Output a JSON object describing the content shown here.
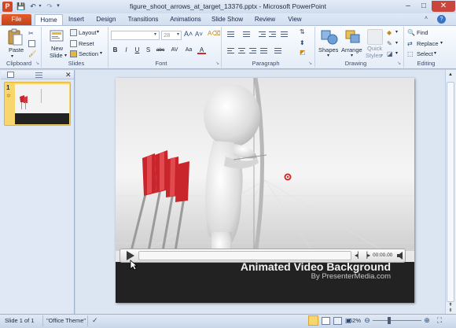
{
  "window": {
    "title": "figure_shoot_arrows_at_target_13376.pptx - Microsoft PowerPoint",
    "app_icon_letter": "P",
    "minimize": "–",
    "maximize": "□",
    "close": "✕"
  },
  "tabs": [
    "File",
    "Home",
    "Insert",
    "Design",
    "Transitions",
    "Animations",
    "Slide Show",
    "Review",
    "View"
  ],
  "ribbon": {
    "clipboard": {
      "label": "Clipboard",
      "paste": "Paste"
    },
    "slides": {
      "label": "Slides",
      "new_slide_1": "New",
      "new_slide_2": "Slide",
      "layout": "Layout",
      "reset": "Reset",
      "section": "Section"
    },
    "font": {
      "label": "Font",
      "size": "28",
      "bold": "B",
      "italic": "I",
      "underline": "U",
      "strike": "S",
      "shadow": "abc",
      "spacing": "AV",
      "case": "Aa",
      "color": "A"
    },
    "paragraph": {
      "label": "Paragraph"
    },
    "drawing": {
      "label": "Drawing",
      "shapes": "Shapes",
      "arrange": "Arrange",
      "quick_styles_1": "Quick",
      "quick_styles_2": "Styles"
    },
    "editing": {
      "label": "Editing",
      "find": "Find",
      "replace": "Replace",
      "select": "Select"
    }
  },
  "slides_pane": {
    "slide_number": "1"
  },
  "video": {
    "time": "00:00.00"
  },
  "slide_text": {
    "headline": "Animated Video Background",
    "byline": "By PresenterMedia.com"
  },
  "status": {
    "slide_info": "Slide 1 of 1",
    "theme": "\"Office Theme\"",
    "zoom": "62%"
  },
  "colors": {
    "file_tab": "#d24726",
    "thumb_selection": "#f8d66e",
    "arrow_fletch": "#c8262c",
    "target": "#d22a2a"
  }
}
